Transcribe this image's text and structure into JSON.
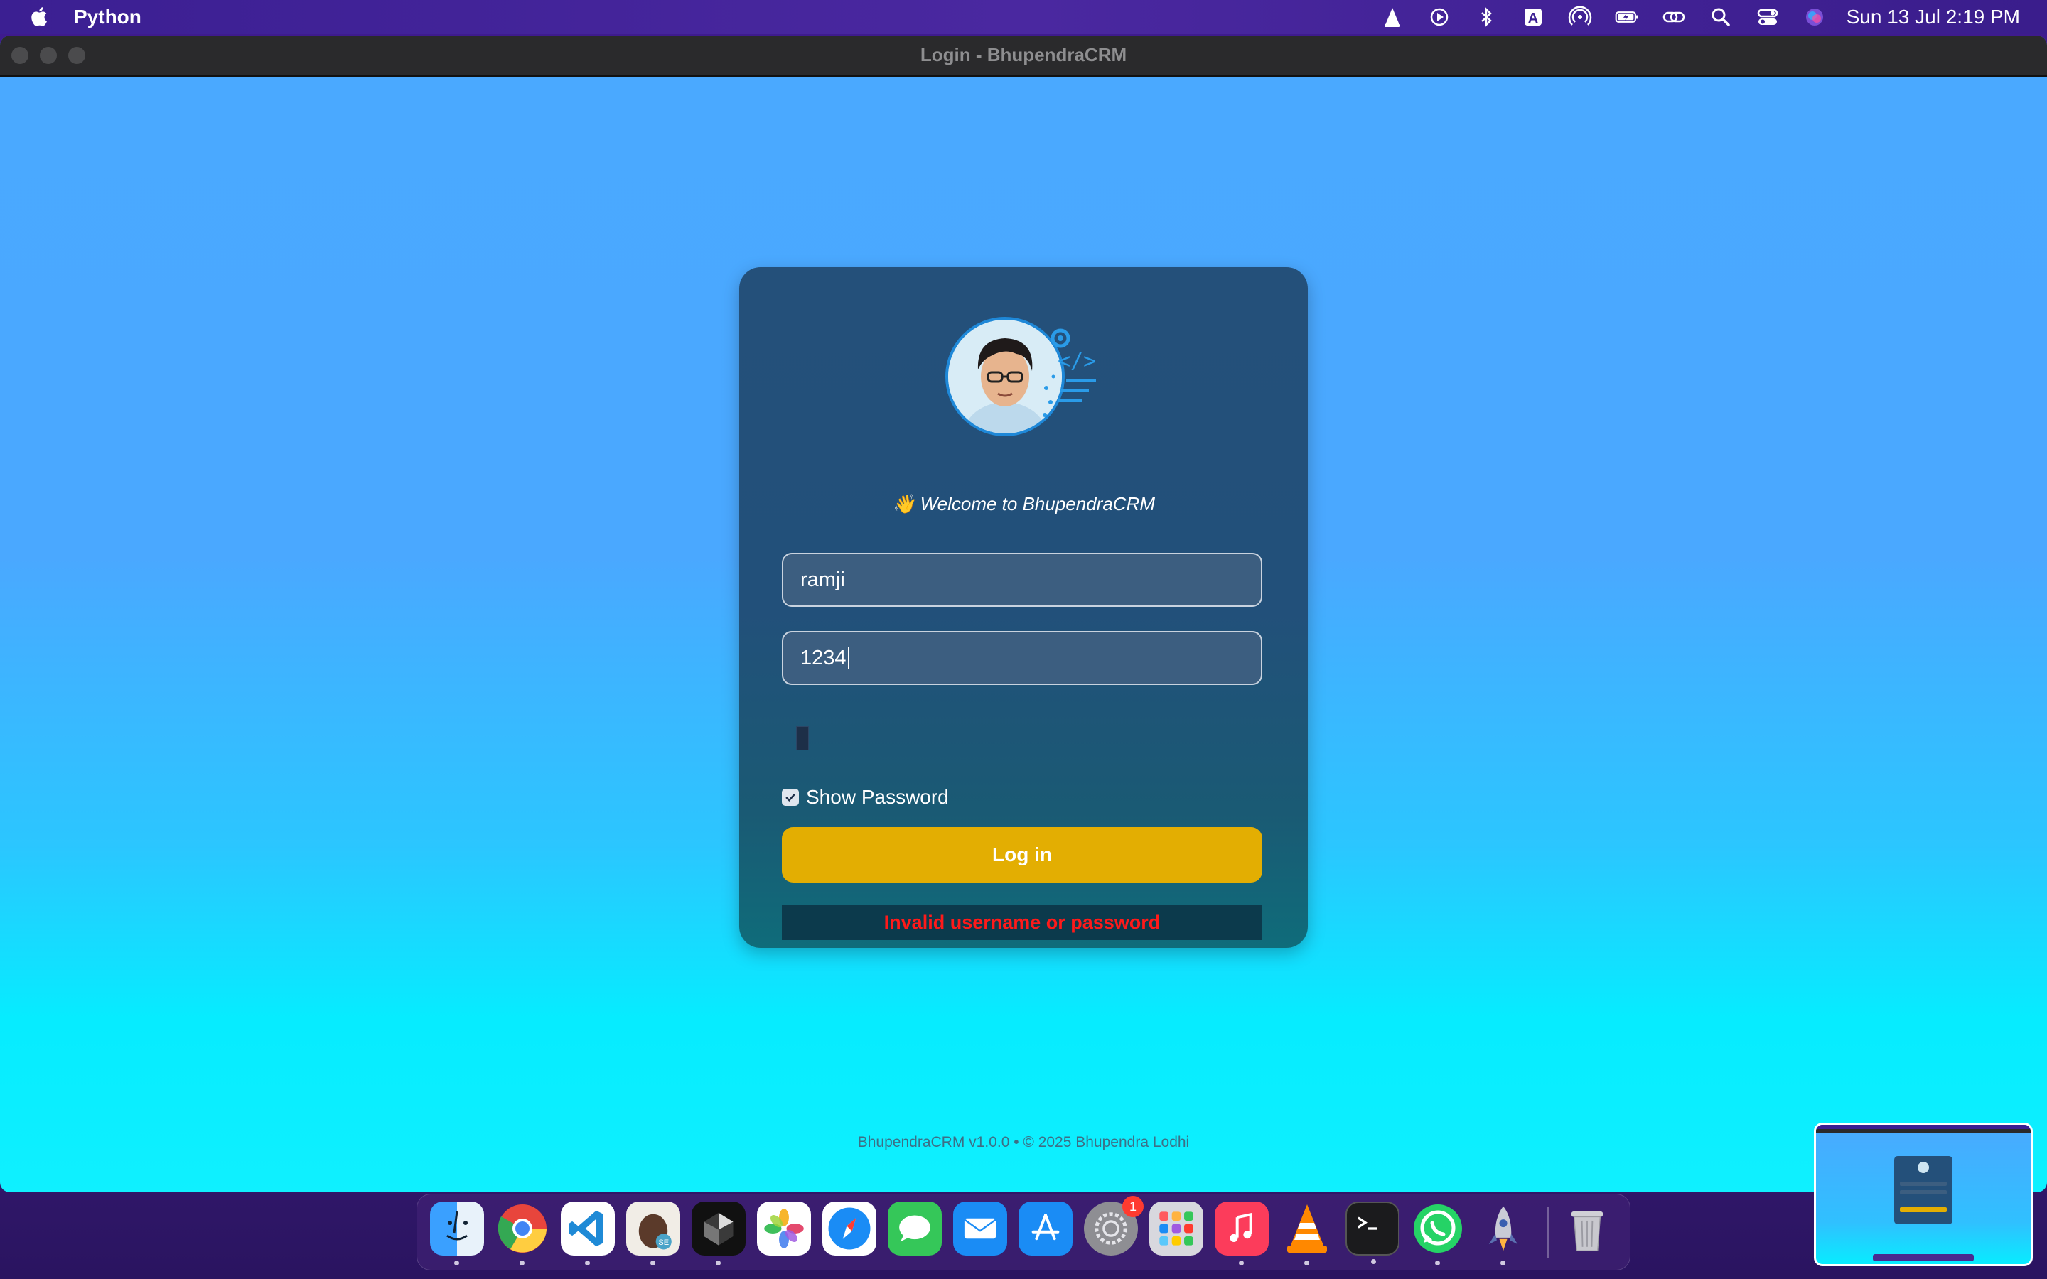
{
  "menubar": {
    "app_name": "Python",
    "clock": "Sun 13 Jul  2:19 PM",
    "status_icons": [
      "vlc-icon",
      "play-circle-icon",
      "bluetooth-icon",
      "input-source-icon",
      "airdrop-icon",
      "battery-icon",
      "link-icon",
      "search-icon",
      "control-center-icon",
      "siri-icon"
    ]
  },
  "window": {
    "title": "Login - BhupendraCRM"
  },
  "login": {
    "welcome": "👋 Welcome to BhupendraCRM",
    "username_value": "ramji",
    "password_value": "1234",
    "show_password_label": "Show Password",
    "show_password_checked": true,
    "login_button": "Log in",
    "error_message": "Invalid username or password"
  },
  "footer": {
    "text": "BhupendraCRM v1.0.0  •  © 2025 Bhupendra Lodhi"
  },
  "dock": {
    "apps": [
      "Finder",
      "Google Chrome",
      "Visual Studio Code",
      "Sequel Ace",
      "Cursor",
      "Photos",
      "Safari",
      "Messages",
      "Mail",
      "App Store",
      "System Settings",
      "Launchpad",
      "Music",
      "VLC",
      "Terminal",
      "WhatsApp",
      "Rocket Typist",
      "Trash"
    ],
    "system_settings_badge": "1"
  },
  "colors": {
    "accent_button": "#e3ae02",
    "error_text": "#ff1a1a",
    "card_bg": "#24507a"
  }
}
